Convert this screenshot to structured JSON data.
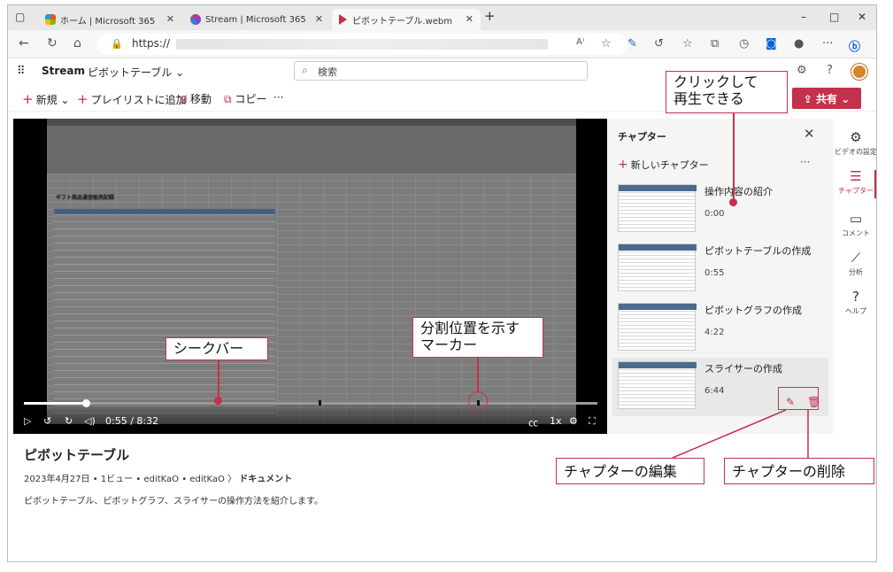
{
  "browser": {
    "tabs": [
      {
        "label": "ホーム | Microsoft 365"
      },
      {
        "label": "Stream | Microsoft 365"
      },
      {
        "label": "ピボットテーブル.webm"
      }
    ],
    "new_tab": "+",
    "url": "https://",
    "window_controls": {
      "minimize": "–",
      "maximize": "□",
      "close": "✕"
    }
  },
  "app": {
    "name": "Stream",
    "breadcrumb": "ピボットテーブル",
    "search_placeholder": "検索"
  },
  "commands": {
    "new": "新規",
    "add_playlist": "プレイリストに追加",
    "move": "移動",
    "copy": "コピー",
    "more": "···",
    "share": "共有"
  },
  "player": {
    "current_time": "0:55",
    "duration": "8:32",
    "time_display": "0:55 / 8:32",
    "speed": "1x",
    "sheet_title": "ギフト商品通信販売記録"
  },
  "video": {
    "title": "ピボットテーブル",
    "date": "2023年4月27日",
    "views": "1ビュー",
    "owner": "editKaO",
    "path_owner": "editKaO",
    "folder": "ドキュメント",
    "description": "ピボットテーブル、ピボットグラフ、スライサーの操作方法を紹介します。"
  },
  "chapters_panel": {
    "title": "チャプター",
    "new_chapter": "新しいチャプター",
    "items": [
      {
        "title": "操作内容の紹介",
        "time": "0:00"
      },
      {
        "title": "ピボットテーブルの作成",
        "time": "0:55"
      },
      {
        "title": "ピボットグラフの作成",
        "time": "4:22"
      },
      {
        "title": "スライサーの作成",
        "time": "6:44"
      }
    ]
  },
  "rail": {
    "video_settings": "ビデオの設定",
    "chapters": "チャプター",
    "comments": "コメント",
    "analytics": "分析",
    "help": "ヘルプ"
  },
  "annotations": {
    "click_to_play": "クリックして\n再生できる",
    "seekbar": "シークバー",
    "split_marker": "分割位置を示す\nマーカー",
    "edit_chapter": "チャプターの編集",
    "delete_chapter": "チャプターの削除"
  },
  "colors": {
    "accent": "#c4314b"
  }
}
